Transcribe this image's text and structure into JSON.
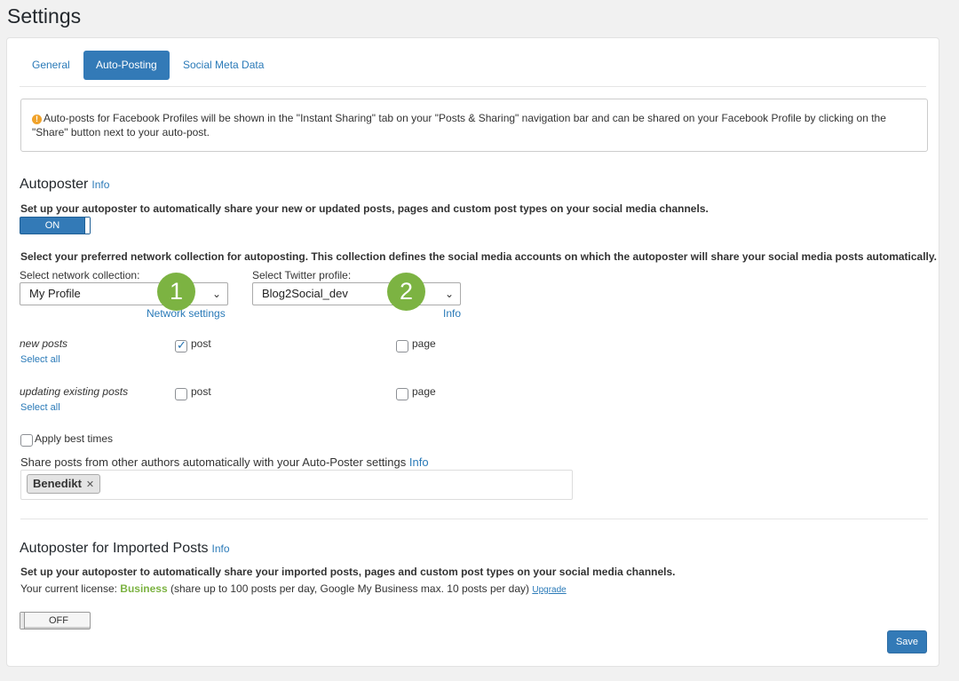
{
  "page": {
    "title": "Settings"
  },
  "tabs": [
    {
      "label": "General"
    },
    {
      "label": "Auto-Posting"
    },
    {
      "label": "Social Meta Data"
    }
  ],
  "notice": {
    "icon": "exclamation-circle-icon",
    "text": "Auto-posts for Facebook Profiles will be shown in the \"Instant Sharing\" tab on your \"Posts & Sharing\" navigation bar and can be shared on your Facebook Profile by clicking on the \"Share\" button next to your auto-post."
  },
  "autoposter": {
    "heading": "Autoposter",
    "info": "Info",
    "description": "Set up your autoposter to automatically share your new or updated posts, pages and custom post types on your social media channels.",
    "toggle": "ON",
    "collection_description": "Select your preferred network collection for autoposting. This collection defines the social media accounts on which the autoposter will share your social media posts automatically.",
    "network_label": "Select network collection:",
    "network_value": "My Profile",
    "network_settings": "Network settings",
    "twitter_label": "Select Twitter profile:",
    "twitter_value": "Blog2Social_dev",
    "twitter_info": "Info",
    "badge1": "1",
    "badge2": "2",
    "new_posts_label": "new posts",
    "updating_label": "updating existing posts",
    "select_all": "Select all",
    "post_label": "post",
    "page_label": "page",
    "apply_best_times": "Apply best times",
    "share_authors": "Share posts from other authors automatically with your Auto-Poster settings",
    "share_authors_info": "Info",
    "author_tag": "Benedikt"
  },
  "checkbox_state": {
    "new_post": true,
    "new_page": false,
    "update_post": false,
    "update_page": false,
    "best_times": false
  },
  "imported": {
    "heading": "Autoposter for Imported Posts",
    "info": "Info",
    "description": "Set up your autoposter to automatically share your imported posts, pages and custom post types on your social media channels.",
    "license_prefix": "Your current license:",
    "license_name": "Business",
    "license_suffix": "(share up to 100 posts per day, Google My Business max. 10 posts per day)",
    "upgrade": "Upgrade",
    "toggle": "OFF"
  },
  "save_label": "Save",
  "colors": {
    "accent": "#337ab7",
    "badge": "#7cb342",
    "warning": "#f0a22a"
  }
}
